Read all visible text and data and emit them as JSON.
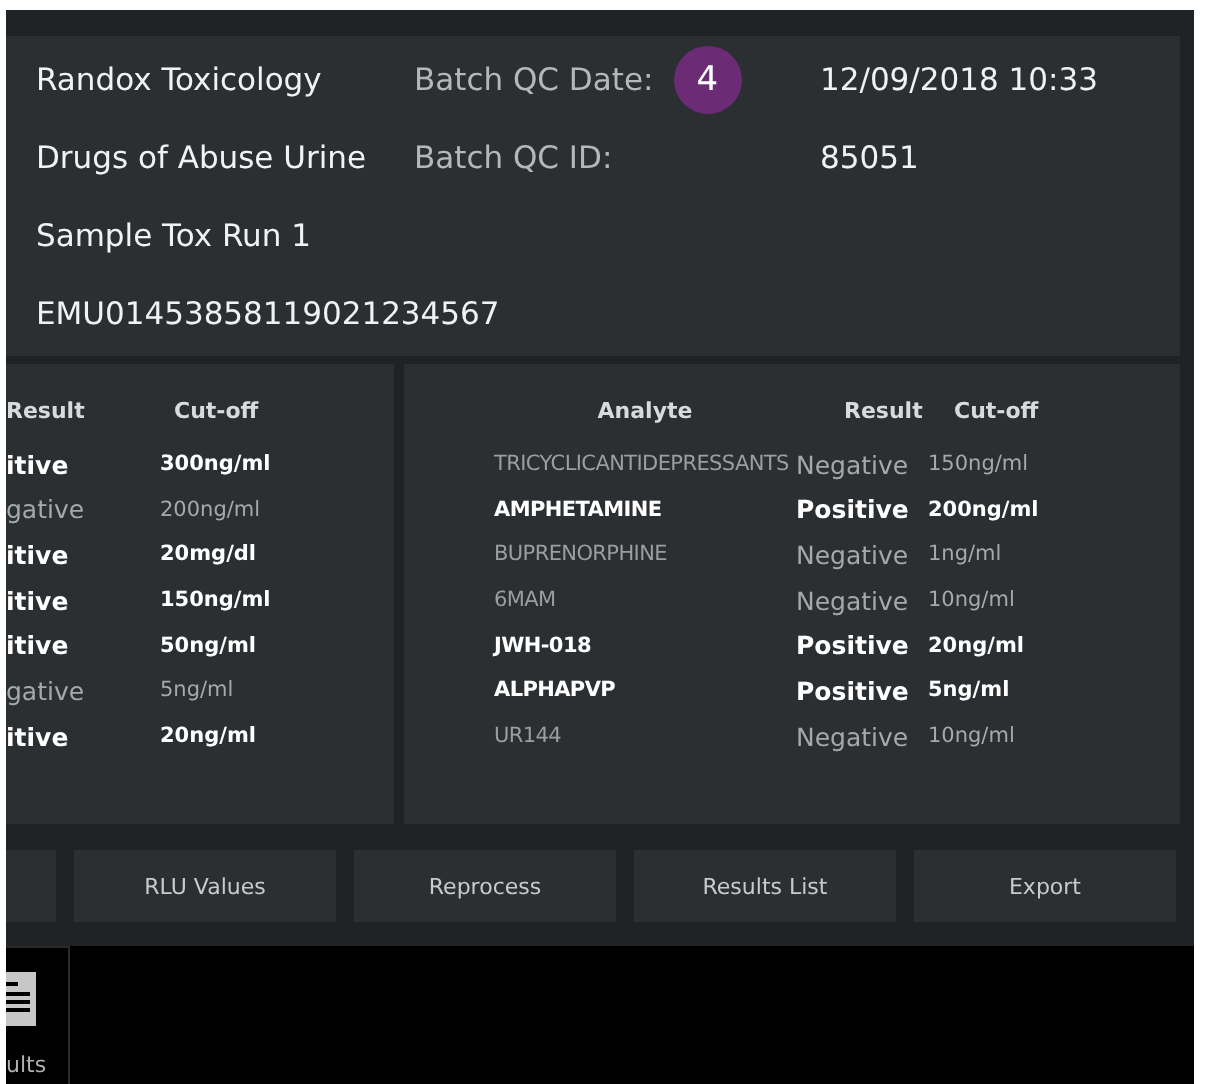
{
  "header": {
    "lines": [
      "Randox Toxicology",
      "Drugs of Abuse Urine",
      "Sample Tox Run 1",
      "EMU01453858119021234567"
    ],
    "fields": [
      {
        "label": "Batch QC Date:",
        "badge": "4",
        "value": "12/09/2018 10:33"
      },
      {
        "label": "Batch QC ID:",
        "value": "85051"
      }
    ]
  },
  "left_table": {
    "columns": [
      "Result",
      "Cut-off"
    ],
    "rows": [
      {
        "result": "itive",
        "cutoff": "300ng/ml",
        "positive": true
      },
      {
        "result": "gative",
        "cutoff": "200ng/ml",
        "positive": false
      },
      {
        "result": "itive",
        "cutoff": "20mg/dl",
        "positive": true
      },
      {
        "result": "itive",
        "cutoff": "150ng/ml",
        "positive": true
      },
      {
        "result": "itive",
        "cutoff": "50ng/ml",
        "positive": true
      },
      {
        "result": "gative",
        "cutoff": "5ng/ml",
        "positive": false
      },
      {
        "result": "itive",
        "cutoff": "20ng/ml",
        "positive": true
      }
    ]
  },
  "right_table": {
    "columns": [
      "Analyte",
      "Result",
      "Cut-off"
    ],
    "rows": [
      {
        "analyte": "TRICYCLICANTIDEPRESSANTS",
        "result": "Negative",
        "cutoff": "150ng/ml",
        "positive": false
      },
      {
        "analyte": "AMPHETAMINE",
        "result": "Positive",
        "cutoff": "200ng/ml",
        "positive": true
      },
      {
        "analyte": "BUPRENORPHINE",
        "result": "Negative",
        "cutoff": "1ng/ml",
        "positive": false
      },
      {
        "analyte": "6MAM",
        "result": "Negative",
        "cutoff": "10ng/ml",
        "positive": false
      },
      {
        "analyte": "JWH-018",
        "result": "Positive",
        "cutoff": "20ng/ml",
        "positive": true
      },
      {
        "analyte": "ALPHAPVP",
        "result": "Positive",
        "cutoff": "5ng/ml",
        "positive": true
      },
      {
        "analyte": "UR144",
        "result": "Negative",
        "cutoff": "10ng/ml",
        "positive": false
      }
    ]
  },
  "buttons": [
    "RLU Values",
    "Reprocess",
    "Results List",
    "Export"
  ],
  "side_tab": {
    "label": "ults"
  }
}
